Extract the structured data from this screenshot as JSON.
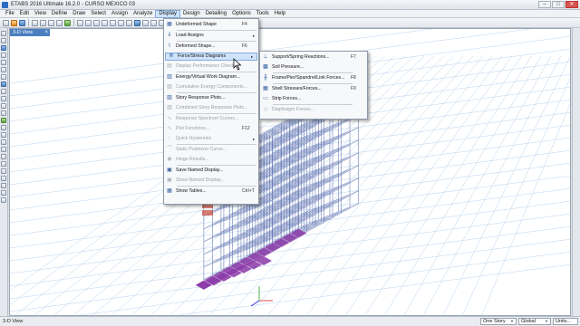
{
  "window": {
    "title": "ETABS 2016 Ultimate 16.2.0 - CURSO MEXICO 03",
    "min": "–",
    "max": "□",
    "close": "✕"
  },
  "menubar": [
    {
      "label": "File"
    },
    {
      "label": "Edit"
    },
    {
      "label": "View"
    },
    {
      "label": "Define"
    },
    {
      "label": "Draw"
    },
    {
      "label": "Select"
    },
    {
      "label": "Assign"
    },
    {
      "label": "Analyze"
    },
    {
      "label": "Display",
      "active": true
    },
    {
      "label": "Design"
    },
    {
      "label": "Detailing"
    },
    {
      "label": "Options"
    },
    {
      "label": "Tools"
    },
    {
      "label": "Help"
    }
  ],
  "view_tab": {
    "label": "3-D View",
    "close": "×"
  },
  "display_menu": {
    "items": [
      {
        "label": "Undeformed Shape",
        "shortcut": "F4",
        "icon": "undeformed-shape-icon"
      },
      {
        "label": "Load Assigns",
        "arrow": "▸",
        "icon": "load-assigns-icon"
      },
      {
        "label": "Deformed Shape...",
        "shortcut": "F6",
        "icon": "deformed-shape-icon"
      },
      {
        "label": "Force/Stress Diagrams",
        "arrow": "▸",
        "icon": "force-diagram-icon",
        "highlight": true
      },
      {
        "label": "Display Performance Check...",
        "disabled": true,
        "icon": "performance-check-icon"
      },
      {
        "label": "Energy/Virtual Work Diagram...",
        "icon": "energy-diagram-icon"
      },
      {
        "label": "Cumulative Energy Components...",
        "disabled": true,
        "icon": "energy-components-icon"
      },
      {
        "label": "Story Response Plots...",
        "icon": "story-response-icon"
      },
      {
        "label": "Combined Story Response Plots...",
        "disabled": true,
        "icon": "combined-response-icon"
      },
      {
        "label": "Response Spectrum Curves...",
        "disabled": true,
        "icon": "spectrum-curves-icon"
      },
      {
        "label": "Plot Functions...",
        "shortcut": "F12",
        "disabled": true,
        "icon": "plot-functions-icon"
      },
      {
        "label": "Quick Hysteresis",
        "arrow": "▸",
        "disabled": true,
        "icon": "hysteresis-icon"
      },
      {
        "label": "Static Pushover Curve...",
        "disabled": true,
        "icon": "pushover-curve-icon"
      },
      {
        "label": "Hinge Results...",
        "disabled": true,
        "icon": "hinge-results-icon"
      },
      {
        "label": "Save Named Display...",
        "icon": "save-display-icon"
      },
      {
        "label": "Show Named Display...",
        "disabled": true,
        "icon": "show-display-icon"
      },
      {
        "label": "Show Tables...",
        "shortcut": "Ctrl+T",
        "icon": "show-tables-icon"
      }
    ]
  },
  "force_submenu": {
    "items": [
      {
        "label": "Support/Spring Reactions...",
        "shortcut": "F7",
        "icon": "reactions-icon"
      },
      {
        "label": "Soil Pressure...",
        "icon": "soil-pressure-icon"
      },
      {
        "label": "Frame/Pier/Spandrel/Link Forces...",
        "shortcut": "F8",
        "icon": "frame-forces-icon"
      },
      {
        "label": "Shell Stresses/Forces...",
        "shortcut": "F9",
        "icon": "shell-stresses-icon"
      },
      {
        "label": "Strip Forces...",
        "icon": "strip-forces-icon"
      },
      {
        "label": "Diaphragm Forces...",
        "disabled": true,
        "icon": "diaphragm-forces-icon"
      }
    ]
  },
  "status": {
    "left": "3-D View",
    "story": "One Story",
    "coord": "Global",
    "units": "Units..."
  },
  "colors": {
    "accent": "#4a7fc1",
    "highlight": "#cfe3fb",
    "structure": "#4d63a8",
    "soil_pressure": "#8b3aa8",
    "grid": "#b9d3ee"
  },
  "icons": {
    "cursor": "mouse-cursor-icon"
  }
}
